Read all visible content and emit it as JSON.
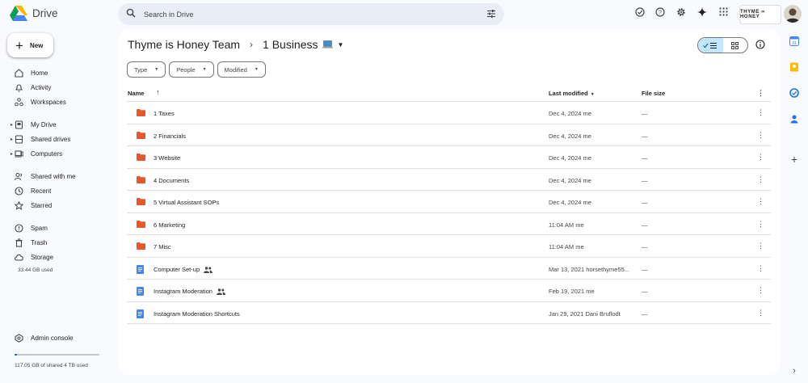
{
  "app": {
    "name": "Drive"
  },
  "search": {
    "placeholder": "Search in Drive"
  },
  "header": {
    "brand": "THYME ∞ HONEY"
  },
  "new_button": {
    "label": "New"
  },
  "nav": {
    "home": "Home",
    "activity": "Activity",
    "workspaces": "Workspaces",
    "my_drive": "My Drive",
    "shared_drives": "Shared drives",
    "computers": "Computers",
    "shared_with_me": "Shared with me",
    "recent": "Recent",
    "starred": "Starred",
    "spam": "Spam",
    "trash": "Trash",
    "storage": "Storage"
  },
  "storage_used": "33.44 GB used",
  "admin_console": "Admin console",
  "shared_storage": {
    "text": "117.05 GB of shared 4 TB used",
    "fraction": 0.029
  },
  "breadcrumb": {
    "parent": "Thyme is Honey Team",
    "current": "1 Business"
  },
  "filters": {
    "type": "Type",
    "people": "People",
    "modified": "Modified"
  },
  "columns": {
    "name": "Name",
    "last_modified": "Last modified",
    "file_size": "File size"
  },
  "rows": [
    {
      "name": "1 Taxes",
      "kind": "folder",
      "modified": "Dec 4, 2024 me",
      "size": "—",
      "shared": false
    },
    {
      "name": "2 Financials",
      "kind": "folder",
      "modified": "Dec 4, 2024 me",
      "size": "—",
      "shared": false
    },
    {
      "name": "3 Website",
      "kind": "folder",
      "modified": "Dec 4, 2024 me",
      "size": "—",
      "shared": false
    },
    {
      "name": "4 Documents",
      "kind": "folder",
      "modified": "Dec 4, 2024 me",
      "size": "—",
      "shared": false
    },
    {
      "name": "5 Virtual Assistant SOPs",
      "kind": "folder",
      "modified": "Dec 4, 2024 me",
      "size": "—",
      "shared": false
    },
    {
      "name": "6 Marketing",
      "kind": "folder",
      "modified": "11:04 AM me",
      "size": "—",
      "shared": false
    },
    {
      "name": "7 Misc",
      "kind": "folder",
      "modified": "11:04 AM me",
      "size": "—",
      "shared": false
    },
    {
      "name": "Computer Set-up",
      "kind": "doc",
      "modified": "Mar 13, 2021 horsethyme55...",
      "size": "—",
      "shared": true
    },
    {
      "name": "Instagram Moderation",
      "kind": "doc",
      "modified": "Feb 19, 2021 me",
      "size": "—",
      "shared": true
    },
    {
      "name": "Instagram Moderation Shortcuts",
      "kind": "doc",
      "modified": "Jan 29, 2021 Dani Bruflodt",
      "size": "—",
      "shared": false
    }
  ],
  "colors": {
    "folder": "#e8572a",
    "doc": "#4285f4",
    "accent": "#0b57d0",
    "selected": "#c2e7ff"
  }
}
